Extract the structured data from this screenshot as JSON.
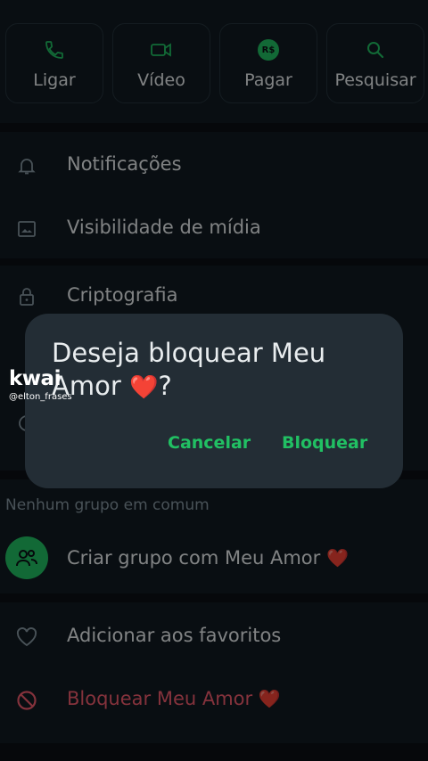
{
  "actions": [
    {
      "label": "Ligar",
      "icon": "phone-icon"
    },
    {
      "label": "Vídeo",
      "icon": "video-icon"
    },
    {
      "label": "Pagar",
      "icon": "payment-icon",
      "badge": "R$"
    },
    {
      "label": "Pesquisar",
      "icon": "search-icon"
    }
  ],
  "settings": {
    "notifications": "Notificações",
    "media_visibility": "Visibilidade de mídia",
    "encryption": "Criptografia"
  },
  "groups": {
    "section_label": "Nenhum grupo em comum",
    "create_group": "Criar grupo com Meu Amor",
    "heart": "❤️"
  },
  "bottom": {
    "add_favorites": "Adicionar aos favoritos",
    "block_contact": "Bloquear Meu Amor"
  },
  "dialog": {
    "title": "Deseja bloquear Meu Amor",
    "title_suffix": "?",
    "cancel_label": "Cancelar",
    "confirm_label": "Bloquear"
  },
  "watermark": {
    "logo": "kwai",
    "handle": "@elton_frases"
  },
  "colors": {
    "accent": "#21c063",
    "danger": "#f15c6d",
    "background": "#111b21",
    "dialog": "#232d35"
  }
}
